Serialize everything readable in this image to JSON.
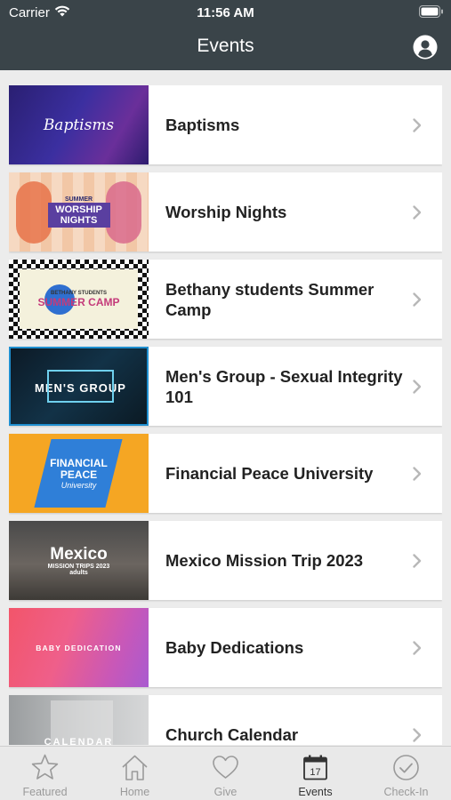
{
  "status": {
    "carrier": "Carrier",
    "time": "11:56 AM"
  },
  "header": {
    "title": "Events"
  },
  "events": [
    {
      "label": "Baptisms",
      "thumb_text": "Baptisms"
    },
    {
      "label": "Worship Nights",
      "thumb_text": "WORSHIP NIGHTS",
      "thumb_small": "SUMMER"
    },
    {
      "label": "Bethany students Summer Camp",
      "thumb_text": "SUMMER CAMP",
      "thumb_small": "BETHANY STUDENTS"
    },
    {
      "label": "Men's Group - Sexual Integrity 101",
      "thumb_text": "MEN'S GROUP"
    },
    {
      "label": "Financial Peace University",
      "thumb_text": "FINANCIAL PEACE",
      "thumb_small": "University"
    },
    {
      "label": "Mexico Mission Trip 2023",
      "thumb_text": "Mexico",
      "thumb_small": "MISSION TRIPS 2023",
      "thumb_small2": "adults"
    },
    {
      "label": "Baby Dedications",
      "thumb_text": "BABY DEDICATION"
    },
    {
      "label": "Church Calendar",
      "thumb_text": "CALENDAR"
    }
  ],
  "tabs": [
    {
      "label": "Featured",
      "icon": "star-icon"
    },
    {
      "label": "Home",
      "icon": "home-icon"
    },
    {
      "label": "Give",
      "icon": "heart-icon"
    },
    {
      "label": "Events",
      "icon": "calendar-icon",
      "active": true,
      "badge": "17"
    },
    {
      "label": "Check-In",
      "icon": "check-circle-icon"
    }
  ],
  "colors": {
    "header_bg": "#3a4449",
    "tab_inactive": "#9a9a9a",
    "tab_active": "#333333"
  }
}
